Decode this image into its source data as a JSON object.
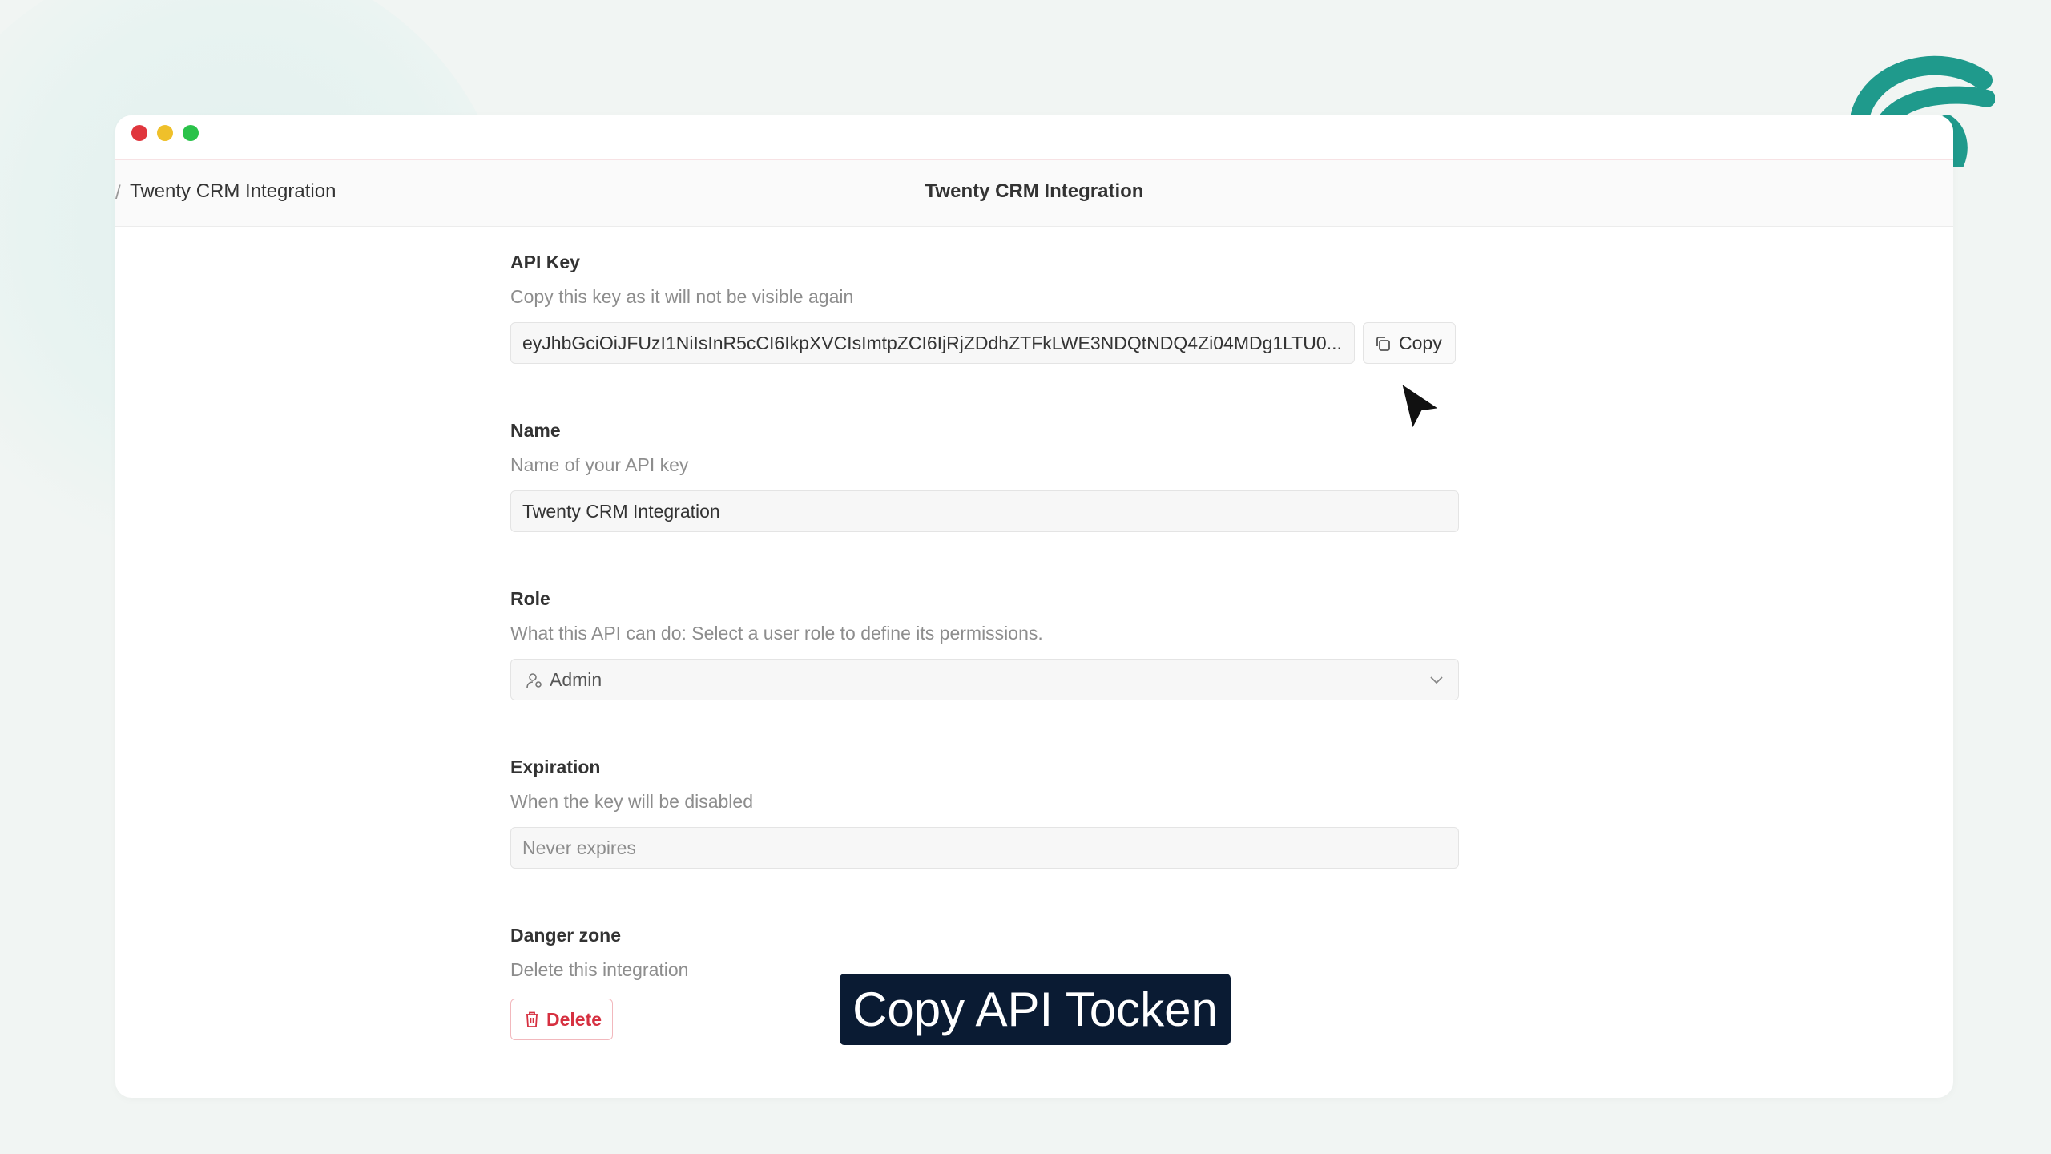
{
  "window": {
    "breadcrumb": "Twenty CRM Integration",
    "title": "Twenty CRM Integration"
  },
  "form": {
    "api_key": {
      "label": "API Key",
      "description": "Copy this key as it will not be visible again",
      "value": "eyJhbGciOiJFUzI1NiIsInR5cCI6IkpXVCIsImtpZCI6IjRjZDdhZTFkLWE3NDQtNDQ4Zi04MDg1LTU0...",
      "copy_label": "Copy"
    },
    "name": {
      "label": "Name",
      "description": "Name of your API key",
      "value": "Twenty CRM Integration"
    },
    "role": {
      "label": "Role",
      "description": "What this API can do: Select a user role to define its permissions.",
      "selected": "Admin"
    },
    "expiration": {
      "label": "Expiration",
      "description": "When the key will be disabled",
      "value": "Never expires"
    },
    "danger_zone": {
      "label": "Danger zone",
      "description": "Delete this integration",
      "delete_label": "Delete"
    }
  },
  "caption": "Copy API Tocken",
  "colors": {
    "brand": "#1f9a8c",
    "danger": "#d63040",
    "caption_bg": "#0a1b33"
  },
  "icons": [
    "copy-icon",
    "user-role-icon",
    "chevron-down-icon",
    "trash-icon",
    "mouse-cursor-icon",
    "brand-logo-icon"
  ]
}
